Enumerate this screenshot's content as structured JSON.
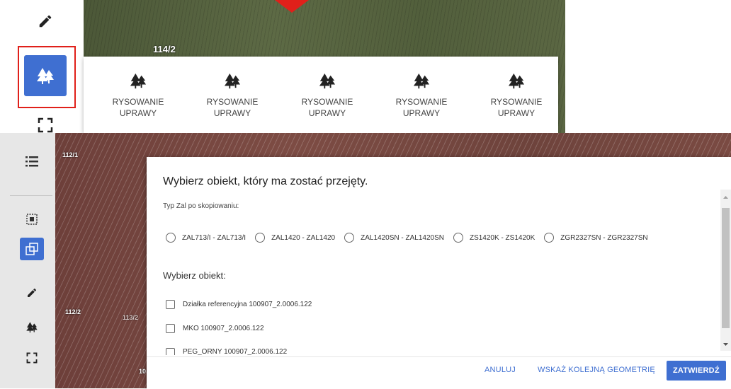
{
  "top_panel": {
    "map_label": "114/2",
    "draw_items": [
      {
        "line1": "RYSOWANIE",
        "line2": "UPRAWY"
      },
      {
        "line1": "RYSOWANIE",
        "line2": "UPRAWY"
      },
      {
        "line1": "RYSOWANIE",
        "line2": "UPRAWY"
      },
      {
        "line1": "RYSOWANIE",
        "line2": "UPRAWY"
      },
      {
        "line1": "RYSOWANIE",
        "line2": "UPRAWY"
      }
    ],
    "tools": [
      "pencil-icon",
      "forest-icon",
      "select-rectangle-icon"
    ],
    "accent": "#3f6fd1",
    "highlight_color": "#e0201a"
  },
  "map": {
    "parcel_labels": [
      "112/1",
      "112/2",
      "113/2",
      "10"
    ]
  },
  "sidebar": {
    "items": [
      "list-icon",
      "select-area-icon",
      "copy-geometry-icon",
      "pencil-icon",
      "forest-icon",
      "select-rectangle-icon"
    ]
  },
  "dialog": {
    "title": "Wybierz obiekt, który ma zostać przejęty.",
    "type_label": "Typ Zal po skopiowaniu:",
    "radio_options": [
      "ZAL713/I - ZAL713/I",
      "ZAL1420 - ZAL1420",
      "ZAL1420SN - ZAL1420SN",
      "ZS1420K - ZS1420K",
      "ZGR2327SN - ZGR2327SN"
    ],
    "object_section": "Wybierz obiekt:",
    "objects": [
      "Działka referencyjna 100907_2.0006.122",
      "MKO 100907_2.0006.122",
      "PEG_ORNY 100907_2.0006.122"
    ],
    "buttons": {
      "cancel": "ANULUJ",
      "next_geometry": "WSKAŻ KOLEJNĄ GEOMETRIĘ",
      "confirm": "ZATWIERDŹ"
    }
  }
}
